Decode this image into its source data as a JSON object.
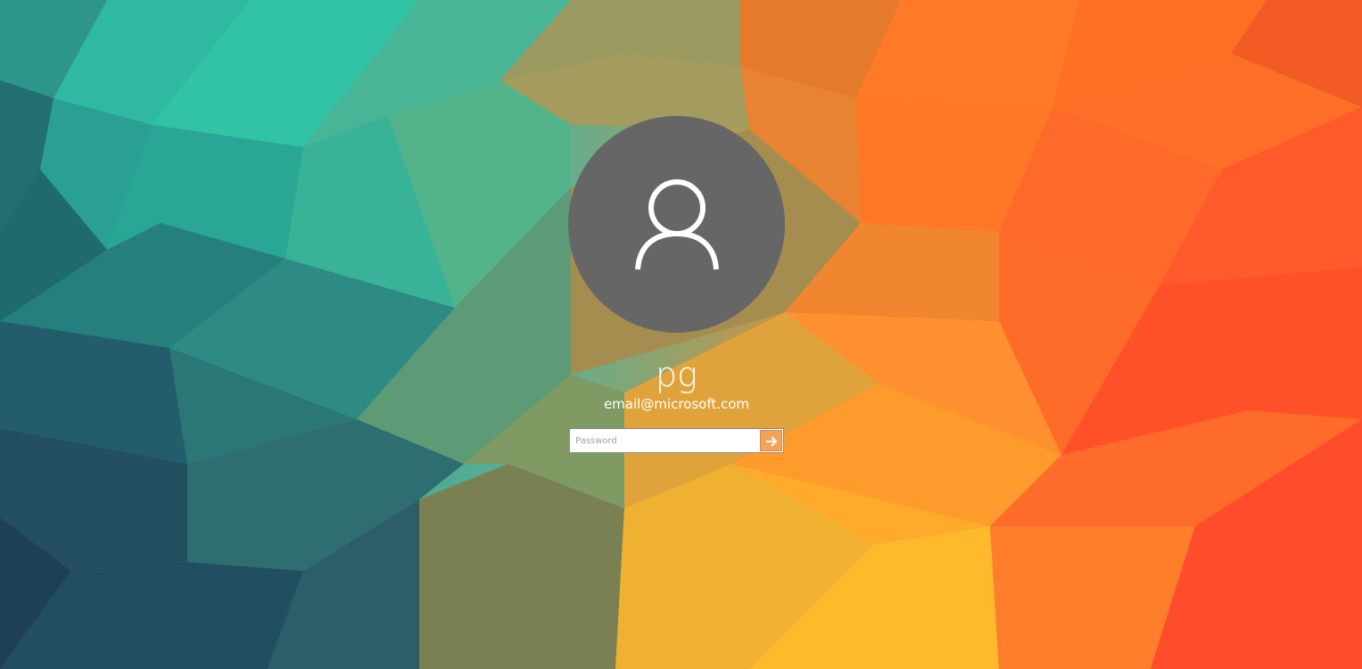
{
  "user": {
    "name": "pg",
    "email": "email@microsoft.com"
  },
  "password_field": {
    "placeholder": "Password",
    "value": ""
  },
  "icons": {
    "avatar": "user-silhouette-icon",
    "submit": "arrow-right-icon"
  },
  "colors": {
    "avatar_background": "#666666",
    "submit_button": "#f2a35a",
    "text": "#ffffff"
  }
}
